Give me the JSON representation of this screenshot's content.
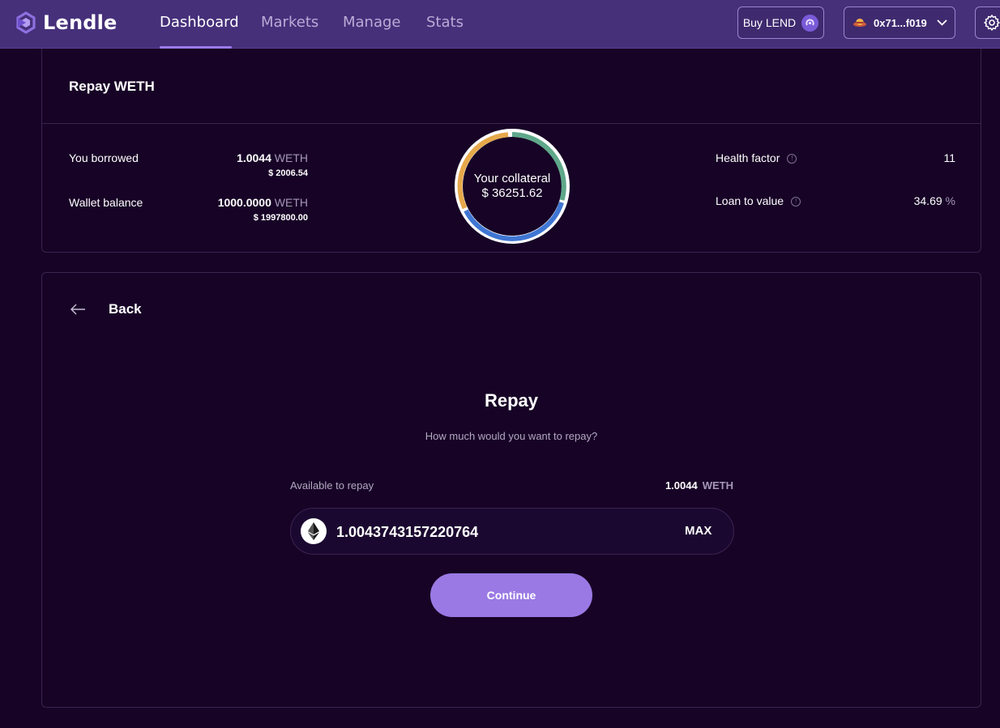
{
  "nav": {
    "brand": "Lendle",
    "links": [
      "Dashboard",
      "Markets",
      "Manage",
      "Stats"
    ],
    "active": "Dashboard",
    "buy_label": "Buy LEND",
    "wallet_address": "0x71...f019"
  },
  "summary": {
    "title": "Repay WETH",
    "borrowed": {
      "label": "You borrowed",
      "amount": "1.0044",
      "unit": "WETH",
      "usd": "$ 2006.54"
    },
    "wallet": {
      "label": "Wallet balance",
      "amount": "1000.0000",
      "unit": "WETH",
      "usd": "$ 1997800.00"
    },
    "collateral": {
      "label": "Your collateral",
      "value": "$ 36251.62"
    },
    "health": {
      "label": "Health factor",
      "value": "11"
    },
    "ltv": {
      "label": "Loan to value",
      "value": "34.69",
      "unit": "%"
    }
  },
  "repay": {
    "back_label": "Back",
    "heading": "Repay",
    "question": "How much would you want to repay?",
    "available_label": "Available to repay",
    "available_amount": "1.0044",
    "available_unit": "WETH",
    "amount_value": "1.0043743157220764",
    "max_label": "MAX",
    "continue_label": "Continue"
  },
  "colors": {
    "nav_bg": "#46307a",
    "page_bg": "#170326",
    "accent": "#9a79e4",
    "donut_orange": "#e6a84a",
    "donut_green": "#5fa88a",
    "donut_blue": "#3f76d3"
  },
  "icons": {
    "logo": "lendle-logo-icon",
    "buy": "lend-coin-icon",
    "wallet": "wallet-avatar-icon",
    "chevron": "chevron-down-icon",
    "settings": "gear-icon",
    "info": "info-icon",
    "back": "arrow-left-icon",
    "token": "ethereum-icon"
  }
}
